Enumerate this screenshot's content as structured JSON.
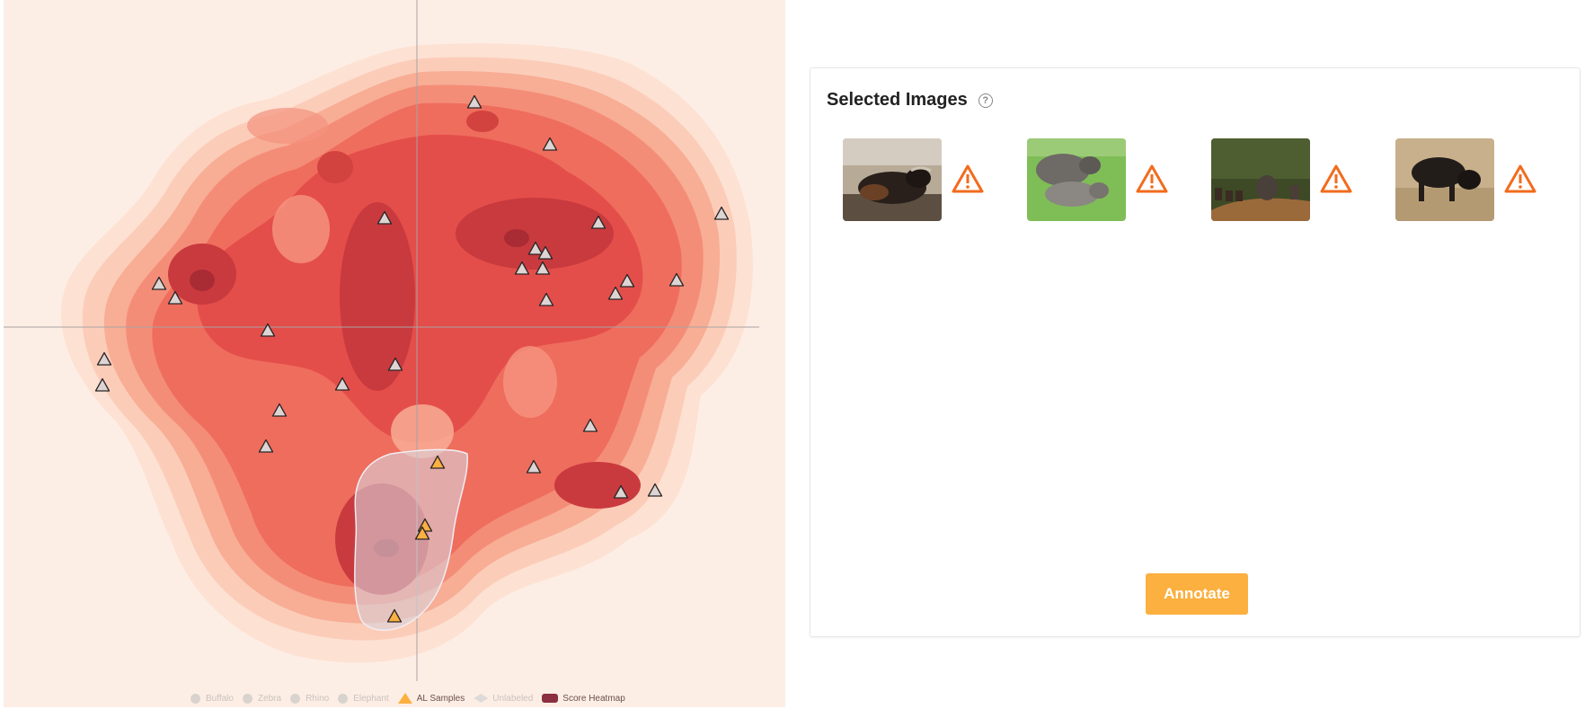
{
  "panel": {
    "title": "Selected Images",
    "help_icon": "question-circle-icon",
    "thumbnails": [
      {
        "alt": "buffalo-lying",
        "warning_icon": "warning-triangle-icon"
      },
      {
        "alt": "buffalos-grass",
        "warning_icon": "warning-triangle-icon"
      },
      {
        "alt": "elephants-road",
        "warning_icon": "warning-triangle-icon"
      },
      {
        "alt": "buffalo-standing",
        "warning_icon": "warning-triangle-icon"
      }
    ],
    "annotate_label": "Annotate"
  },
  "legend": [
    {
      "label": "Buffalo",
      "icon": "circle-icon",
      "active": false
    },
    {
      "label": "Zebra",
      "icon": "circle-icon",
      "active": false
    },
    {
      "label": "Rhino",
      "icon": "circle-icon",
      "active": false
    },
    {
      "label": "Elephant",
      "icon": "circle-icon",
      "active": false
    },
    {
      "label": "AL Samples",
      "icon": "triangle-icon",
      "active": true
    },
    {
      "label": "Unlabeled",
      "icon": "diamond-icon",
      "active": false
    },
    {
      "label": "Score Heatmap",
      "icon": "rect-icon",
      "active": true
    }
  ],
  "colors": {
    "accent": "#fbb040",
    "warning": "#f26b1d",
    "heatmap_light": "#fde3d7",
    "heatmap_dark": "#c2343c"
  }
}
